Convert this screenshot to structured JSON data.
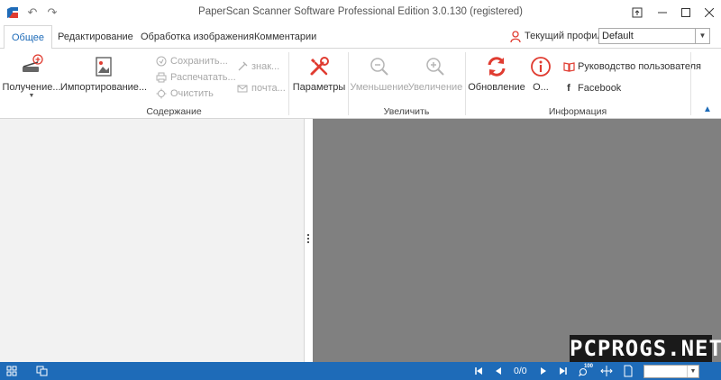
{
  "window": {
    "title": "PaperScan Scanner Software Professional Edition 3.0.130 (registered)"
  },
  "tabs": [
    {
      "label": "Общее",
      "active": true
    },
    {
      "label": "Редактирование",
      "active": false
    },
    {
      "label": "Обработка изображения",
      "active": false
    },
    {
      "label": "Комментарии",
      "active": false
    }
  ],
  "profile": {
    "label": "Текущий профиль:",
    "value": "Default"
  },
  "ribbon": {
    "acquire_label": "Получение...",
    "import_label": "Импортирование...",
    "save_label": "Сохранить...",
    "print_label": "Распечатать...",
    "clear_label": "Очистить",
    "stamp_label": "знак...",
    "mail_label": "почта...",
    "settings_label": "Параметры",
    "content_group": "Содержание",
    "zoom_out_label": "Уменьшение",
    "zoom_in_label": "Увеличение",
    "zoom_group": "Увеличить",
    "update_label": "Обновление",
    "about_label": "О...",
    "manual_label": "Руководство пользователя",
    "facebook_label": "Facebook",
    "info_group": "Информация"
  },
  "statusbar": {
    "page_counter": "0/0",
    "zoom_badge": "100"
  },
  "watermark": {
    "text": "PCPROGS.NET"
  },
  "colors": {
    "accent": "#1e6bb8",
    "viewer_bg": "#808080",
    "left_pane_bg": "#f2f2f2"
  }
}
